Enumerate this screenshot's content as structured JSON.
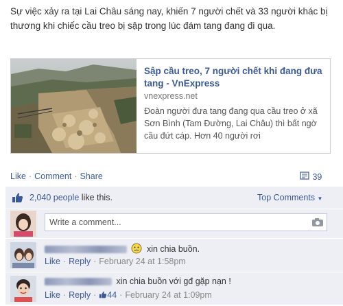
{
  "post": {
    "text": "Sự việc xảy ra tại Lai Châu sáng nay, khiến 7 người chết và 33 người khác bị thương khi chiếc cầu treo bị sập trong lúc đám tang đang đi qua."
  },
  "share": {
    "title": "Sập cầu treo, 7 người chết khi đang đưa tang - VnExpress",
    "source": "vnexpress.net",
    "description": "Đoàn người đưa tang đang qua cầu treo ở xã Sơn Bình (Tam Đường, Lai Châu) thì bất ngờ cầu đứt cáp. Hơn 40 người rơi"
  },
  "actions": {
    "like": "Like",
    "comment": "Comment",
    "share": "Share",
    "comment_count": "39"
  },
  "likes": {
    "count_link": "2,040 people",
    "suffix": " like this.",
    "sort": "Top Comments"
  },
  "composer": {
    "placeholder": "Write a comment..."
  },
  "comments": [
    {
      "text": "xin chia buồn.",
      "like": "Like",
      "reply": "Reply",
      "time": "February 24 at 1:58pm"
    },
    {
      "text": "xin chia buồn với gđ gặp nạn !",
      "like": "Like",
      "reply": "Reply",
      "likes": "44",
      "time": "February 24 at 1:09pm"
    }
  ],
  "colors": {
    "link": "#3b5998",
    "ufi_background": "#edeff4"
  }
}
